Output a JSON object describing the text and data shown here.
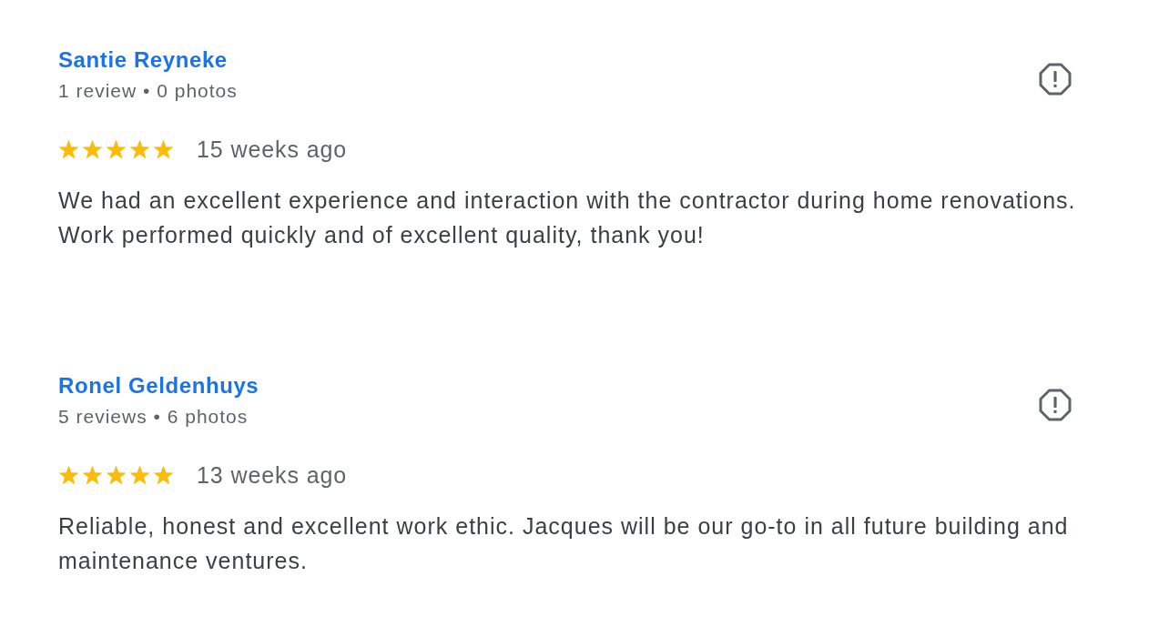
{
  "reviews": [
    {
      "author": "Santie Reyneke",
      "meta": "1 review • 0 photos",
      "stars": 5,
      "time": "15 weeks ago",
      "text": "We had an excellent experience and interaction with the contractor during home renovations. Work performed quickly and of excellent quality, thank you!"
    },
    {
      "author": "Ronel Geldenhuys",
      "meta": "5 reviews • 6 photos",
      "stars": 5,
      "time": "13 weeks ago",
      "text": "Reliable, honest and excellent work ethic. Jacques will be our go-to in all future building and maintenance ventures."
    }
  ]
}
